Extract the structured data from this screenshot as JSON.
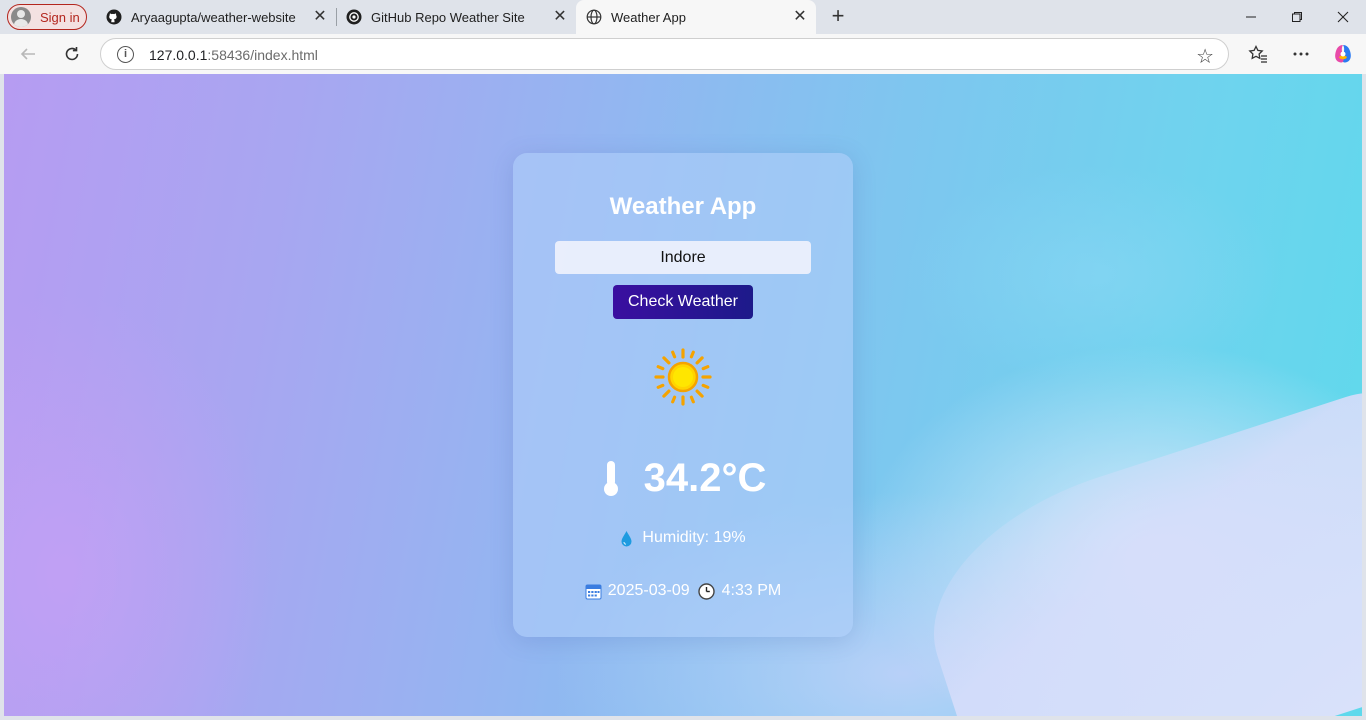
{
  "browser": {
    "signin_label": "Sign in",
    "tabs": [
      {
        "title": "Aryaagupta/weather-website",
        "icon": "github-icon"
      },
      {
        "title": "GitHub Repo Weather Site",
        "icon": "openai-icon"
      },
      {
        "title": "Weather App",
        "icon": "globe-icon",
        "active": true
      }
    ],
    "address": {
      "host": "127.0.0.1",
      "rest": ":58436/index.html"
    }
  },
  "app": {
    "title": "Weather App",
    "city_value": "Indore",
    "check_button": "Check Weather",
    "weather_icon": "sun-icon",
    "temperature": "34.2°C",
    "humidity": "Humidity: 19%",
    "date": "2025-03-09",
    "time": "4:33 PM"
  },
  "colors": {
    "button_bg": "#2a148f",
    "signin_border": "#b3261e",
    "sun_yellow": "#ffd400"
  }
}
